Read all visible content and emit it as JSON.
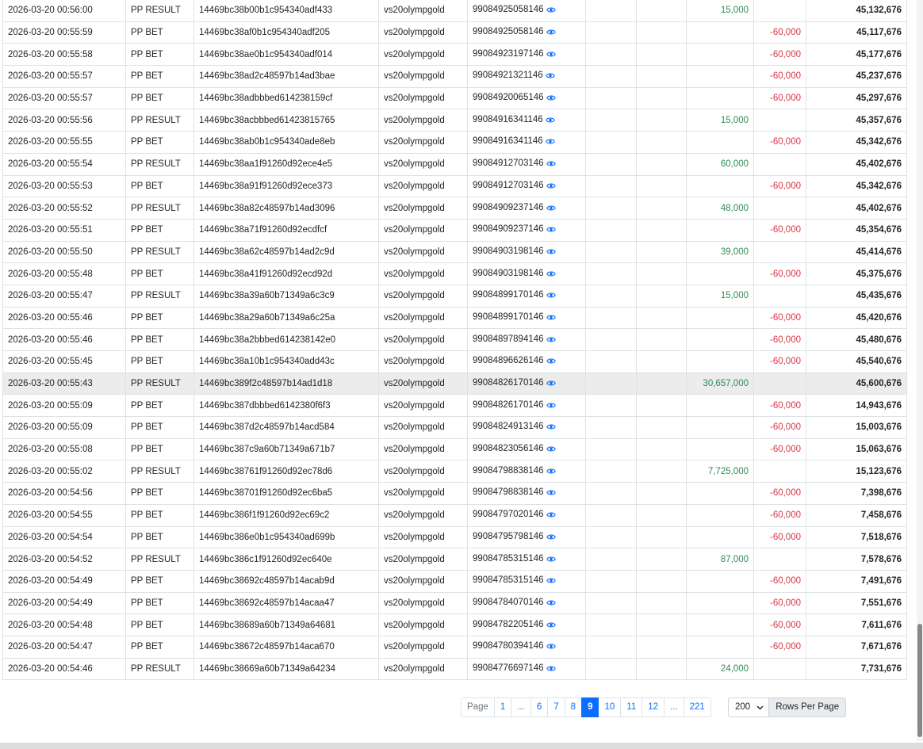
{
  "table": {
    "rows": [
      {
        "time": "2026-03-20 00:56:00",
        "type": "PP RESULT",
        "txid": "14469bc38b00b1c954340adf433",
        "game": "vs20olympgold",
        "round": "99084925058146",
        "win": "15,000",
        "bet": "",
        "balance": "45,132,676"
      },
      {
        "time": "2026-03-20 00:55:59",
        "type": "PP BET",
        "txid": "14469bc38af0b1c954340adf205",
        "game": "vs20olympgold",
        "round": "99084925058146",
        "win": "",
        "bet": "-60,000",
        "balance": "45,117,676"
      },
      {
        "time": "2026-03-20 00:55:58",
        "type": "PP BET",
        "txid": "14469bc38ae0b1c954340adf014",
        "game": "vs20olympgold",
        "round": "99084923197146",
        "win": "",
        "bet": "-60,000",
        "balance": "45,177,676"
      },
      {
        "time": "2026-03-20 00:55:57",
        "type": "PP BET",
        "txid": "14469bc38ad2c48597b14ad3bae",
        "game": "vs20olympgold",
        "round": "99084921321146",
        "win": "",
        "bet": "-60,000",
        "balance": "45,237,676"
      },
      {
        "time": "2026-03-20 00:55:57",
        "type": "PP BET",
        "txid": "14469bc38adbbbed614238159cf",
        "game": "vs20olympgold",
        "round": "99084920065146",
        "win": "",
        "bet": "-60,000",
        "balance": "45,297,676"
      },
      {
        "time": "2026-03-20 00:55:56",
        "type": "PP RESULT",
        "txid": "14469bc38acbbbed61423815765",
        "game": "vs20olympgold",
        "round": "99084916341146",
        "win": "15,000",
        "bet": "",
        "balance": "45,357,676"
      },
      {
        "time": "2026-03-20 00:55:55",
        "type": "PP BET",
        "txid": "14469bc38ab0b1c954340ade8eb",
        "game": "vs20olympgold",
        "round": "99084916341146",
        "win": "",
        "bet": "-60,000",
        "balance": "45,342,676"
      },
      {
        "time": "2026-03-20 00:55:54",
        "type": "PP RESULT",
        "txid": "14469bc38aa1f91260d92ece4e5",
        "game": "vs20olympgold",
        "round": "99084912703146",
        "win": "60,000",
        "bet": "",
        "balance": "45,402,676"
      },
      {
        "time": "2026-03-20 00:55:53",
        "type": "PP BET",
        "txid": "14469bc38a91f91260d92ece373",
        "game": "vs20olympgold",
        "round": "99084912703146",
        "win": "",
        "bet": "-60,000",
        "balance": "45,342,676"
      },
      {
        "time": "2026-03-20 00:55:52",
        "type": "PP RESULT",
        "txid": "14469bc38a82c48597b14ad3096",
        "game": "vs20olympgold",
        "round": "99084909237146",
        "win": "48,000",
        "bet": "",
        "balance": "45,402,676"
      },
      {
        "time": "2026-03-20 00:55:51",
        "type": "PP BET",
        "txid": "14469bc38a71f91260d92ecdfcf",
        "game": "vs20olympgold",
        "round": "99084909237146",
        "win": "",
        "bet": "-60,000",
        "balance": "45,354,676"
      },
      {
        "time": "2026-03-20 00:55:50",
        "type": "PP RESULT",
        "txid": "14469bc38a62c48597b14ad2c9d",
        "game": "vs20olympgold",
        "round": "99084903198146",
        "win": "39,000",
        "bet": "",
        "balance": "45,414,676"
      },
      {
        "time": "2026-03-20 00:55:48",
        "type": "PP BET",
        "txid": "14469bc38a41f91260d92ecd92d",
        "game": "vs20olympgold",
        "round": "99084903198146",
        "win": "",
        "bet": "-60,000",
        "balance": "45,375,676"
      },
      {
        "time": "2026-03-20 00:55:47",
        "type": "PP RESULT",
        "txid": "14469bc38a39a60b71349a6c3c9",
        "game": "vs20olympgold",
        "round": "99084899170146",
        "win": "15,000",
        "bet": "",
        "balance": "45,435,676"
      },
      {
        "time": "2026-03-20 00:55:46",
        "type": "PP BET",
        "txid": "14469bc38a29a60b71349a6c25a",
        "game": "vs20olympgold",
        "round": "99084899170146",
        "win": "",
        "bet": "-60,000",
        "balance": "45,420,676"
      },
      {
        "time": "2026-03-20 00:55:46",
        "type": "PP BET",
        "txid": "14469bc38a2bbbed614238142e0",
        "game": "vs20olympgold",
        "round": "99084897894146",
        "win": "",
        "bet": "-60,000",
        "balance": "45,480,676"
      },
      {
        "time": "2026-03-20 00:55:45",
        "type": "PP BET",
        "txid": "14469bc38a10b1c954340add43c",
        "game": "vs20olympgold",
        "round": "99084896626146",
        "win": "",
        "bet": "-60,000",
        "balance": "45,540,676"
      },
      {
        "time": "2026-03-20 00:55:43",
        "type": "PP RESULT",
        "txid": "14469bc389f2c48597b14ad1d18",
        "game": "vs20olympgold",
        "round": "99084826170146",
        "win": "30,657,000",
        "bet": "",
        "balance": "45,600,676",
        "highlight": true
      },
      {
        "time": "2026-03-20 00:55:09",
        "type": "PP BET",
        "txid": "14469bc387dbbbed6142380f6f3",
        "game": "vs20olympgold",
        "round": "99084826170146",
        "win": "",
        "bet": "-60,000",
        "balance": "14,943,676"
      },
      {
        "time": "2026-03-20 00:55:09",
        "type": "PP BET",
        "txid": "14469bc387d2c48597b14acd584",
        "game": "vs20olympgold",
        "round": "99084824913146",
        "win": "",
        "bet": "-60,000",
        "balance": "15,003,676"
      },
      {
        "time": "2026-03-20 00:55:08",
        "type": "PP BET",
        "txid": "14469bc387c9a60b71349a671b7",
        "game": "vs20olympgold",
        "round": "99084823056146",
        "win": "",
        "bet": "-60,000",
        "balance": "15,063,676"
      },
      {
        "time": "2026-03-20 00:55:02",
        "type": "PP RESULT",
        "txid": "14469bc38761f91260d92ec78d6",
        "game": "vs20olympgold",
        "round": "99084798838146",
        "win": "7,725,000",
        "bet": "",
        "balance": "15,123,676"
      },
      {
        "time": "2026-03-20 00:54:56",
        "type": "PP BET",
        "txid": "14469bc38701f91260d92ec6ba5",
        "game": "vs20olympgold",
        "round": "99084798838146",
        "win": "",
        "bet": "-60,000",
        "balance": "7,398,676"
      },
      {
        "time": "2026-03-20 00:54:55",
        "type": "PP BET",
        "txid": "14469bc386f1f91260d92ec69c2",
        "game": "vs20olympgold",
        "round": "99084797020146",
        "win": "",
        "bet": "-60,000",
        "balance": "7,458,676"
      },
      {
        "time": "2026-03-20 00:54:54",
        "type": "PP BET",
        "txid": "14469bc386e0b1c954340ad699b",
        "game": "vs20olympgold",
        "round": "99084795798146",
        "win": "",
        "bet": "-60,000",
        "balance": "7,518,676"
      },
      {
        "time": "2026-03-20 00:54:52",
        "type": "PP RESULT",
        "txid": "14469bc386c1f91260d92ec640e",
        "game": "vs20olympgold",
        "round": "99084785315146",
        "win": "87,000",
        "bet": "",
        "balance": "7,578,676"
      },
      {
        "time": "2026-03-20 00:54:49",
        "type": "PP BET",
        "txid": "14469bc38692c48597b14acab9d",
        "game": "vs20olympgold",
        "round": "99084785315146",
        "win": "",
        "bet": "-60,000",
        "balance": "7,491,676"
      },
      {
        "time": "2026-03-20 00:54:49",
        "type": "PP BET",
        "txid": "14469bc38692c48597b14acaa47",
        "game": "vs20olympgold",
        "round": "99084784070146",
        "win": "",
        "bet": "-60,000",
        "balance": "7,551,676"
      },
      {
        "time": "2026-03-20 00:54:48",
        "type": "PP BET",
        "txid": "14469bc38689a60b71349a64681",
        "game": "vs20olympgold",
        "round": "99084782205146",
        "win": "",
        "bet": "-60,000",
        "balance": "7,611,676"
      },
      {
        "time": "2026-03-20 00:54:47",
        "type": "PP BET",
        "txid": "14469bc38672c48597b14aca670",
        "game": "vs20olympgold",
        "round": "99084780394146",
        "win": "",
        "bet": "-60,000",
        "balance": "7,671,676"
      },
      {
        "time": "2026-03-20 00:54:46",
        "type": "PP RESULT",
        "txid": "14469bc38669a60b71349a64234",
        "game": "vs20olympgold",
        "round": "99084776697146",
        "win": "24,000",
        "bet": "",
        "balance": "7,731,676"
      }
    ]
  },
  "icons": {
    "round_detail": "eye-icon"
  },
  "colors": {
    "win": "#2e8b57",
    "loss": "#dc3545",
    "accent": "#0d6efd",
    "highlight_row": "#ececec"
  },
  "pagination": {
    "label": "Page",
    "items": [
      {
        "text": "1"
      },
      {
        "text": "...",
        "ellipsis": true
      },
      {
        "text": "6"
      },
      {
        "text": "7"
      },
      {
        "text": "8"
      },
      {
        "text": "9",
        "active": true
      },
      {
        "text": "10"
      },
      {
        "text": "11"
      },
      {
        "text": "12"
      },
      {
        "text": "...",
        "ellipsis": true
      },
      {
        "text": "221"
      }
    ],
    "current_page": "9"
  },
  "rows_per_page": {
    "value": "200",
    "label": "Rows Per Page"
  }
}
